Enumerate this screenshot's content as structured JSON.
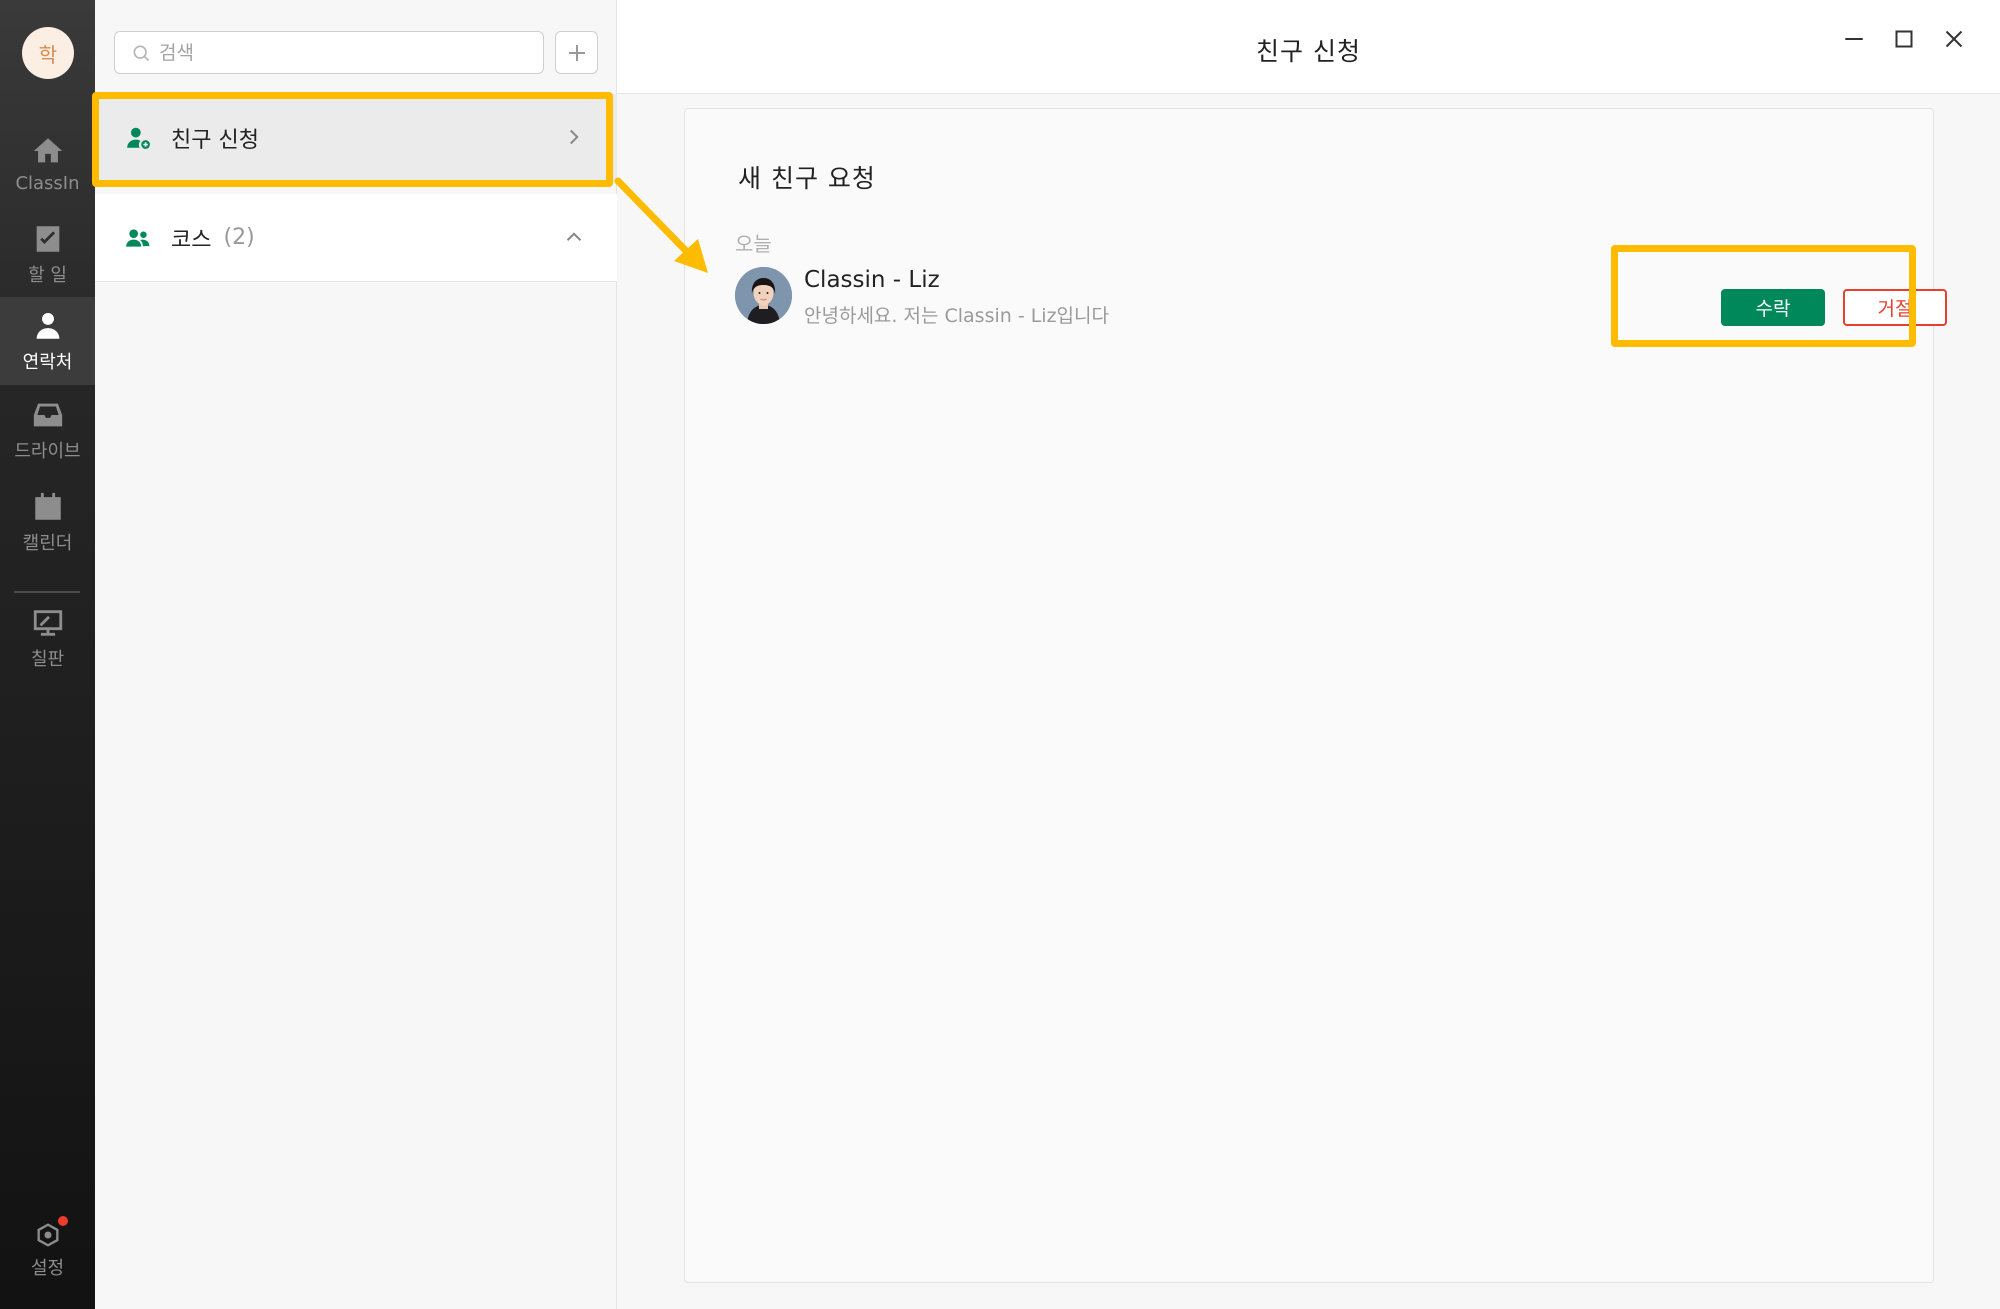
{
  "app": {
    "user_initial": "학",
    "notification_dot_color": "#ee3b2b"
  },
  "nav": {
    "items": [
      {
        "label": "ClassIn",
        "icon": "home-icon"
      },
      {
        "label": "할 일",
        "icon": "checklist-icon"
      },
      {
        "label": "연락처",
        "icon": "contacts-icon",
        "active": true
      },
      {
        "label": "드라이브",
        "icon": "drive-icon"
      },
      {
        "label": "캘린더",
        "icon": "calendar-icon"
      },
      {
        "label": "칠판",
        "icon": "blackboard-icon"
      }
    ],
    "settings_label": "설정"
  },
  "contacts": {
    "search_placeholder": "검색",
    "friend_request_label": "친구 신청",
    "course_label": "코스",
    "course_count": "(2)"
  },
  "window": {
    "title": "친구 신청"
  },
  "requests": {
    "heading": "새 친구 요청",
    "group_label": "오늘",
    "items": [
      {
        "name": "Classin - Liz",
        "message": "안녕하세요. 저는 Classin - Liz입니다",
        "accept_label": "수락",
        "reject_label": "거절"
      }
    ]
  },
  "colors": {
    "accent_green": "#00875a",
    "reject_red": "#e6402e",
    "highlight_yellow": "#ffbb00",
    "rail_dark": "#1c1c1c"
  }
}
